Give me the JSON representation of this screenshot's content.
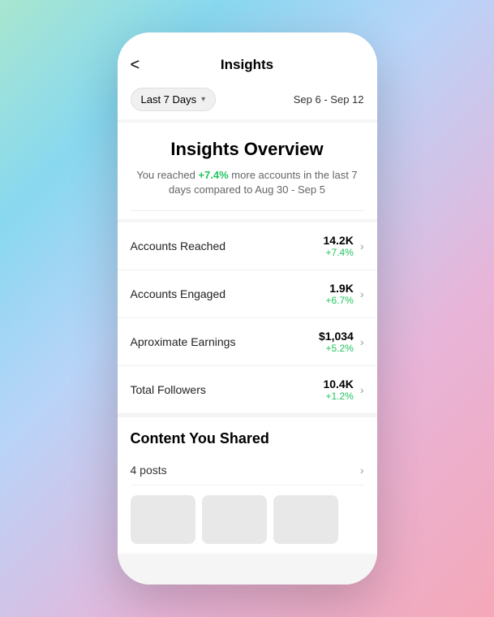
{
  "header": {
    "title": "Insights",
    "back_label": "<"
  },
  "filter": {
    "label": "Last 7 Days",
    "chevron": "▾",
    "date_range": "Sep 6 - Sep 12"
  },
  "overview": {
    "title": "Insights Overview",
    "description_prefix": "You reached ",
    "highlight": "+7.4%",
    "description_suffix": " more accounts in the last 7 days compared to Aug 30 - Sep 5"
  },
  "metrics": [
    {
      "label": "Accounts Reached",
      "value": "14.2K",
      "change": "+7.4%"
    },
    {
      "label": "Accounts Engaged",
      "value": "1.9K",
      "change": "+6.7%"
    },
    {
      "label": "Aproximate Earnings",
      "value": "$1,034",
      "change": "+5.2%"
    },
    {
      "label": "Total Followers",
      "value": "10.4K",
      "change": "+1.2%"
    }
  ],
  "content": {
    "title": "Content You Shared",
    "posts_label": "4 posts",
    "thumbnails": [
      "thumb1",
      "thumb2",
      "thumb3"
    ]
  }
}
